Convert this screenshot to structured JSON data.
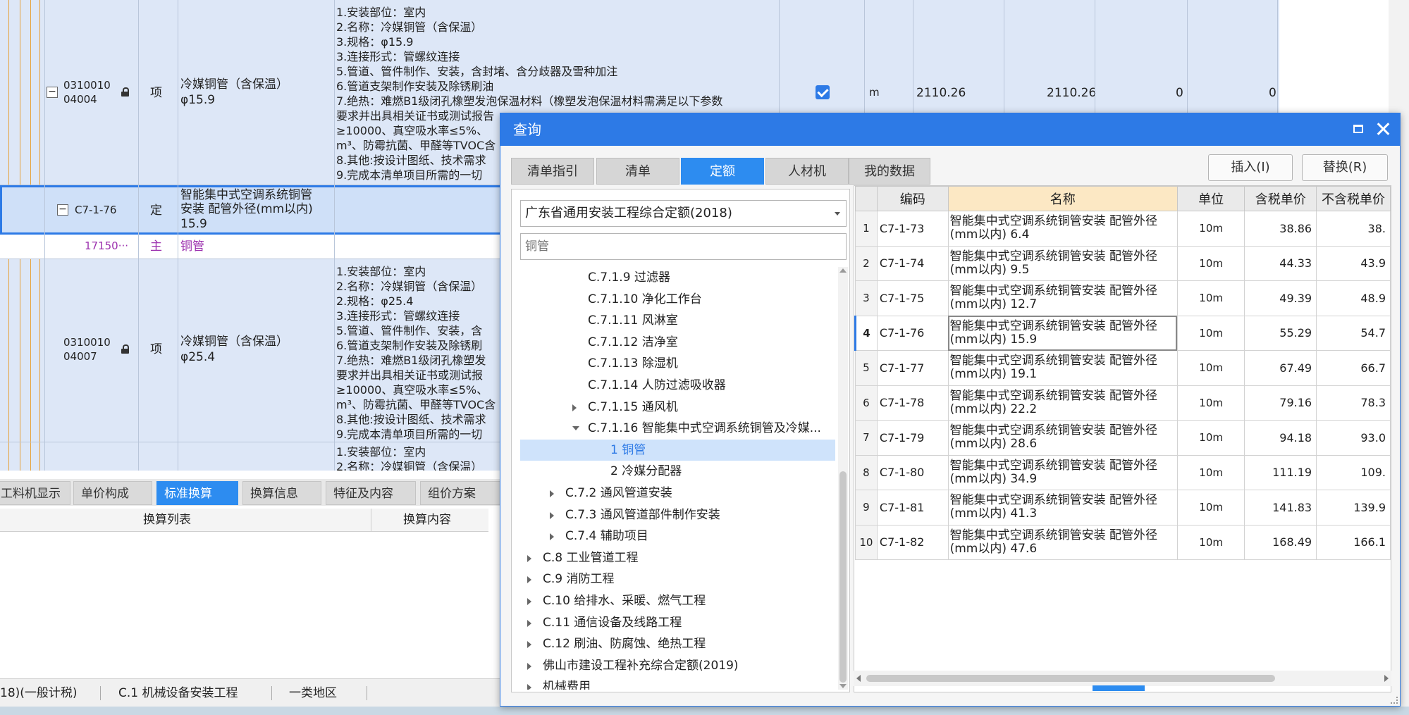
{
  "grid": {
    "row1": {
      "code_line1": "0310010",
      "code_line2": "04004",
      "type": "项",
      "name_line1": "冷媒铜管（含保温）",
      "name_line2": "φ15.9",
      "description": "1.安装部位：室内\n2.名称：冷媒铜管（含保温）\n3.规格：φ15.9\n3.连接形式：管螺纹连接\n5.管道、管件制作、安装，含封堵、含分歧器及雪种加注\n6.管道支架制作安装及除锈刷油\n7.绝热：难燃B1级闭孔橡塑发泡保温材料（橡塑发泡保温材料需满足以下参数\n要求并出具相关证书或测试报告\n≥10000、真空吸水率≤5%、\nm³、防霉抗菌、甲醛等TVOC含\n8.其他:按设计图纸、技术需求\n9.完成本清单项目所需的一切",
      "unit": "m",
      "qty1": "2110.26",
      "qty2": "2110.26",
      "val1": "0",
      "val2": "0"
    },
    "row2": {
      "code": "C7-1-76",
      "type": "定",
      "name_line1": "智能集中式空调系统铜管",
      "name_line2": "安装 配管外径(mm以内)",
      "name_line3": "15.9"
    },
    "row3": {
      "code": "17150···",
      "type": "主",
      "name": "铜管"
    },
    "row4": {
      "code_line1": "0310010",
      "code_line2": "04007",
      "type": "项",
      "name_line1": "冷媒铜管（含保温）",
      "name_line2": "φ25.4",
      "description": "1.安装部位：室内\n2.名称：冷媒铜管（含保温）\n2.规格：φ25.4\n3.连接形式：管螺纹连接\n5.管道、管件制作、安装，含\n6.管道支架制作安装及除锈刷\n7.绝热：难燃B1级闭孔橡塑发\n要求并出具相关证书或测试报\n≥10000、真空吸水率≤5%、\nm³、防霉抗菌、甲醛等TVOC含\n8.其他:按设计图纸、技术需求\n9.完成本清单项目所需的一切"
    },
    "row5": {
      "description": "1.安装部位：室内\n2.名称：冷媒铜管（含保温）"
    }
  },
  "bottom_tabs": [
    "工料机显示",
    "单价构成",
    "标准换算",
    "换算信息",
    "特征及内容",
    "组价方案"
  ],
  "bottom_active_tab": "标准换算",
  "conversion": {
    "col1": "换算列表",
    "col2": "换算内容"
  },
  "status": {
    "item1": "18)(一般计税)",
    "item2": "C.1 机械设备安装工程",
    "item3": "一类地区"
  },
  "dialog": {
    "title": "查询",
    "tabs": [
      "清单指引",
      "清单",
      "定额",
      "人材机",
      "我的数据"
    ],
    "active_tab": "定额",
    "insert_button": "插入(I)",
    "replace_button": "替换(R)",
    "library": "广东省通用安装工程综合定额(2018)",
    "search_placeholder": "铜管",
    "tree": [
      {
        "label": "C.7.1.9 过滤器",
        "indent": 3,
        "arrow": "none"
      },
      {
        "label": "C.7.1.10 净化工作台",
        "indent": 3,
        "arrow": "none"
      },
      {
        "label": "C.7.1.11 风淋室",
        "indent": 3,
        "arrow": "none"
      },
      {
        "label": "C.7.1.12 洁净室",
        "indent": 3,
        "arrow": "none"
      },
      {
        "label": "C.7.1.13 除湿机",
        "indent": 3,
        "arrow": "none"
      },
      {
        "label": "C.7.1.14 人防过滤吸收器",
        "indent": 3,
        "arrow": "none"
      },
      {
        "label": "C.7.1.15 通风机",
        "indent": 3,
        "arrow": "closed"
      },
      {
        "label": "C.7.1.16 智能集中式空调系统铜管及冷媒...",
        "indent": 3,
        "arrow": "open"
      },
      {
        "label": "1 铜管",
        "indent": 4,
        "arrow": "none",
        "selected": true
      },
      {
        "label": "2 冷媒分配器",
        "indent": 4,
        "arrow": "none"
      },
      {
        "label": "C.7.2 通风管道安装",
        "indent": 2,
        "arrow": "closed"
      },
      {
        "label": "C.7.3 通风管道部件制作安装",
        "indent": 2,
        "arrow": "closed"
      },
      {
        "label": "C.7.4 辅助项目",
        "indent": 2,
        "arrow": "closed"
      },
      {
        "label": "C.8 工业管道工程",
        "indent": 1,
        "arrow": "closed"
      },
      {
        "label": "C.9 消防工程",
        "indent": 1,
        "arrow": "closed"
      },
      {
        "label": "C.10 给排水、采暖、燃气工程",
        "indent": 1,
        "arrow": "closed"
      },
      {
        "label": "C.11 通信设备及线路工程",
        "indent": 1,
        "arrow": "closed"
      },
      {
        "label": "C.12 刷油、防腐蚀、绝热工程",
        "indent": 1,
        "arrow": "closed"
      },
      {
        "label": "佛山市建设工程补充综合定额(2019)",
        "indent": 1,
        "arrow": "closed"
      },
      {
        "label": "机械费用",
        "indent": 1,
        "arrow": "closed"
      }
    ],
    "table": {
      "headers": [
        "",
        "编码",
        "名称",
        "单位",
        "含税单价",
        "不含税单价"
      ],
      "active_row": 4,
      "rows": [
        {
          "idx": "1",
          "code": "C7-1-73",
          "name": "智能集中式空调系统铜管安装 配管外径(mm以内) 6.4",
          "unit": "10m",
          "p1": "38.86",
          "p2": "38."
        },
        {
          "idx": "2",
          "code": "C7-1-74",
          "name": "智能集中式空调系统铜管安装 配管外径(mm以内) 9.5",
          "unit": "10m",
          "p1": "44.33",
          "p2": "43.9"
        },
        {
          "idx": "3",
          "code": "C7-1-75",
          "name": "智能集中式空调系统铜管安装 配管外径(mm以内) 12.7",
          "unit": "10m",
          "p1": "49.39",
          "p2": "48.9"
        },
        {
          "idx": "4",
          "code": "C7-1-76",
          "name": "智能集中式空调系统铜管安装 配管外径(mm以内) 15.9",
          "unit": "10m",
          "p1": "55.29",
          "p2": "54.7"
        },
        {
          "idx": "5",
          "code": "C7-1-77",
          "name": "智能集中式空调系统铜管安装 配管外径(mm以内) 19.1",
          "unit": "10m",
          "p1": "67.49",
          "p2": "66.7"
        },
        {
          "idx": "6",
          "code": "C7-1-78",
          "name": "智能集中式空调系统铜管安装 配管外径(mm以内) 22.2",
          "unit": "10m",
          "p1": "79.16",
          "p2": "78.3"
        },
        {
          "idx": "7",
          "code": "C7-1-79",
          "name": "智能集中式空调系统铜管安装 配管外径(mm以内) 28.6",
          "unit": "10m",
          "p1": "94.18",
          "p2": "93.0"
        },
        {
          "idx": "8",
          "code": "C7-1-80",
          "name": "智能集中式空调系统铜管安装 配管外径(mm以内) 34.9",
          "unit": "10m",
          "p1": "111.19",
          "p2": "109."
        },
        {
          "idx": "9",
          "code": "C7-1-81",
          "name": "智能集中式空调系统铜管安装 配管外径(mm以内) 41.3",
          "unit": "10m",
          "p1": "141.83",
          "p2": "139.9"
        },
        {
          "idx": "10",
          "code": "C7-1-82",
          "name": "智能集中式空调系统铜管安装 配管外径(mm以内) 47.6",
          "unit": "10m",
          "p1": "168.49",
          "p2": "166.1"
        }
      ]
    }
  }
}
